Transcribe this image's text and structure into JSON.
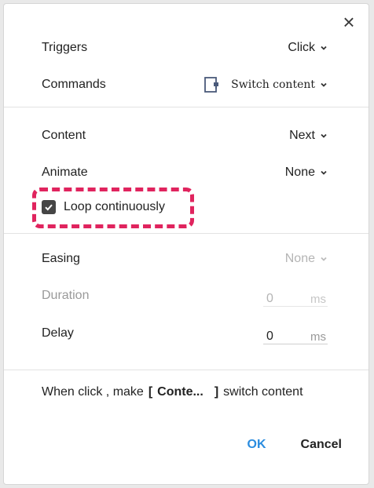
{
  "dialog": {
    "close_glyph": "×",
    "triggers": {
      "label": "Triggers",
      "value": "Click"
    },
    "commands": {
      "label": "Commands",
      "value": "Switch content",
      "icon": "switch-content-icon"
    },
    "content": {
      "label": "Content",
      "value": "Next"
    },
    "animate": {
      "label": "Animate",
      "value": "None"
    },
    "loop": {
      "label": "Loop continuously",
      "checked": true
    },
    "easing": {
      "label": "Easing",
      "value": "None",
      "disabled": true
    },
    "duration": {
      "label": "Duration",
      "value": "0",
      "unit": "ms",
      "disabled": true
    },
    "delay": {
      "label": "Delay",
      "value": "0",
      "unit": "ms"
    },
    "summary": {
      "prefix": "When click , make",
      "open_bracket": "[",
      "target": "Conte...",
      "close_bracket": "]",
      "suffix": "switch content"
    },
    "ok_label": "OK",
    "cancel_label": "Cancel"
  },
  "colors": {
    "highlight": "#e0245e",
    "ok": "#2a8cdf",
    "checkbox": "#454545"
  }
}
